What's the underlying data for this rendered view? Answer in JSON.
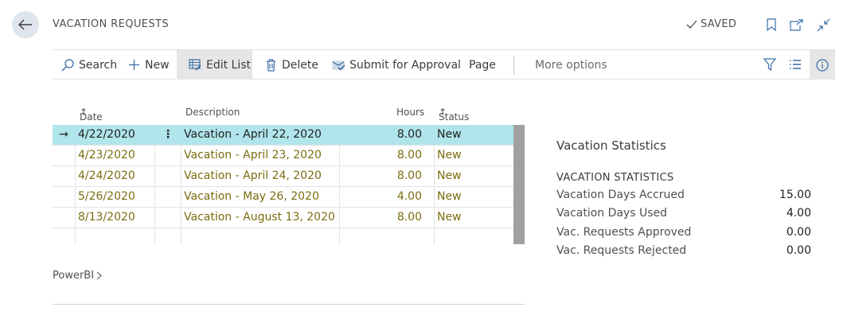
{
  "header": {
    "title": "VACATION REQUESTS",
    "saved_label": "SAVED"
  },
  "toolbar": {
    "search": "Search",
    "new": "New",
    "edit_list": "Edit List",
    "delete": "Delete",
    "submit": "Submit for Approval",
    "page": "Page",
    "more": "More options"
  },
  "grid": {
    "columns": {
      "date": "Date",
      "description": "Description",
      "hours": "Hours",
      "status": "Status"
    },
    "rows": [
      {
        "date": "4/22/2020",
        "description": "Vacation - April 22, 2020",
        "hours": "8.00",
        "status": "New"
      },
      {
        "date": "4/23/2020",
        "description": "Vacation - April 23, 2020",
        "hours": "8.00",
        "status": "New"
      },
      {
        "date": "4/24/2020",
        "description": "Vacation - April 24, 2020",
        "hours": "8.00",
        "status": "New"
      },
      {
        "date": "5/26/2020",
        "description": "Vacation - May 26, 2020",
        "hours": "4.00",
        "status": "New"
      },
      {
        "date": "8/13/2020",
        "description": "Vacation - August 13, 2020",
        "hours": "8.00",
        "status": "New"
      }
    ],
    "selected_row_color": "#b0e5eb",
    "row_text_color": "#7b6d0f"
  },
  "powerbi": {
    "label": "PowerBI"
  },
  "stats": {
    "title": "Vacation Statistics",
    "subtitle": "VACATION STATISTICS",
    "items": [
      {
        "label": "Vacation Days Accrued",
        "value": "15.00"
      },
      {
        "label": "Vacation Days Used",
        "value": "4.00"
      },
      {
        "label": "Vac. Requests Approved",
        "value": "0.00"
      },
      {
        "label": "Vac. Requests Rejected",
        "value": "0.00"
      }
    ]
  },
  "icons": [
    "back-arrow-icon",
    "checkmark-icon",
    "bookmark-icon",
    "open-new-window-icon",
    "collapse-icon",
    "search-icon",
    "plus-icon",
    "edit-list-icon",
    "trash-icon",
    "submit-approval-icon",
    "filter-icon",
    "list-view-icon",
    "info-icon",
    "row-arrow-icon",
    "row-menu-icon",
    "chevron-right-icon"
  ]
}
